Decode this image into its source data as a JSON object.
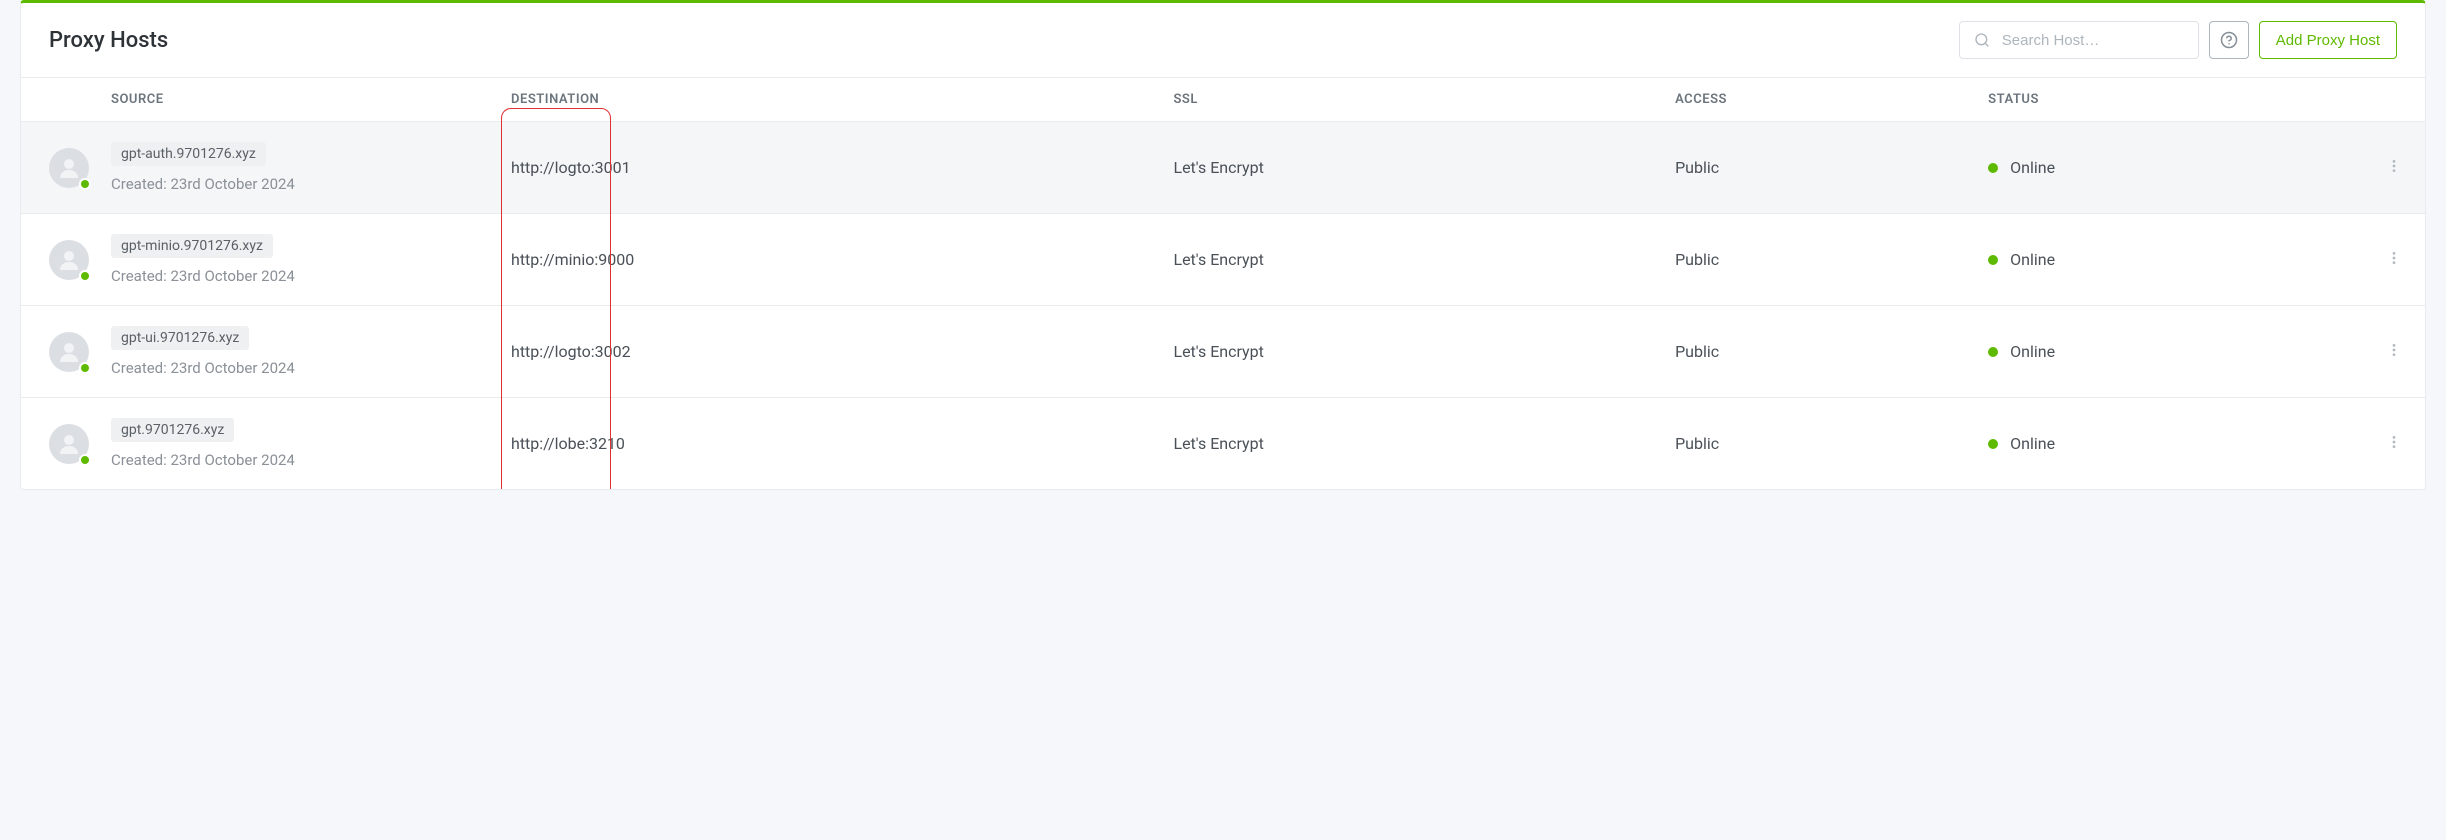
{
  "header": {
    "title": "Proxy Hosts",
    "search_placeholder": "Search Host…",
    "add_button": "Add Proxy Host"
  },
  "columns": {
    "source": "SOURCE",
    "destination": "DESTINATION",
    "ssl": "SSL",
    "access": "ACCESS",
    "status": "STATUS"
  },
  "rows": [
    {
      "host": "gpt-auth.9701276.xyz",
      "created": "Created: 23rd October 2024",
      "destination": "http://logto:3001",
      "ssl": "Let's Encrypt",
      "access": "Public",
      "status": "Online",
      "highlight": true
    },
    {
      "host": "gpt-minio.9701276.xyz",
      "created": "Created: 23rd October 2024",
      "destination": "http://minio:9000",
      "ssl": "Let's Encrypt",
      "access": "Public",
      "status": "Online",
      "highlight": false
    },
    {
      "host": "gpt-ui.9701276.xyz",
      "created": "Created: 23rd October 2024",
      "destination": "http://logto:3002",
      "ssl": "Let's Encrypt",
      "access": "Public",
      "status": "Online",
      "highlight": false
    },
    {
      "host": "gpt.9701276.xyz",
      "created": "Created: 23rd October 2024",
      "destination": "http://lobe:3210",
      "ssl": "Let's Encrypt",
      "access": "Public",
      "status": "Online",
      "highlight": false
    }
  ],
  "annotation": {
    "purpose": "highlight-destination-column",
    "color": "#e03131"
  }
}
